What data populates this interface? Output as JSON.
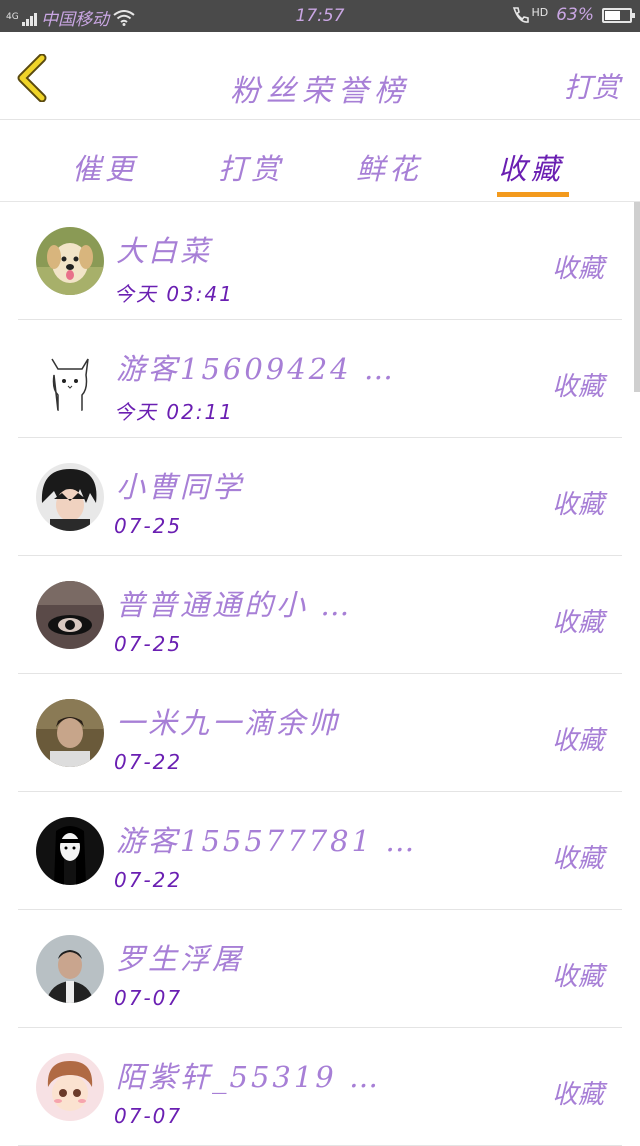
{
  "status_bar": {
    "network": "4G",
    "carrier": "中国移动",
    "time": "17:57",
    "hd": "HD",
    "battery_percent_label": "63%",
    "battery_level": 0.63,
    "signal_icon": "signal-bars-icon",
    "wifi_icon": "wifi-icon",
    "call_icon": "phone-hd-icon",
    "battery_icon": "battery-icon"
  },
  "header": {
    "back_icon": "chevron-left-icon",
    "title": "粉丝荣誉榜",
    "reward_label": "打赏"
  },
  "tabs": [
    {
      "label": "催更",
      "active": false
    },
    {
      "label": "打赏",
      "active": false
    },
    {
      "label": "鲜花",
      "active": false
    },
    {
      "label": "收藏",
      "active": true
    }
  ],
  "colors": {
    "accent_purple": "#a77fd6",
    "dark_purple": "#6a1fb2",
    "indicator_orange": "#f39a1d",
    "back_icon_yellow": "#f0d428"
  },
  "fans": [
    {
      "name": "大白菜",
      "time": "今天 03:41",
      "action": "收藏",
      "avatar": "puppy-avatar"
    },
    {
      "name": "游客15609424 …",
      "time": "今天 02:11",
      "action": "收藏",
      "avatar": "cat-sketch-avatar"
    },
    {
      "name": "小曹同学",
      "time": "07-25",
      "action": "收藏",
      "avatar": "anime-boy-avatar"
    },
    {
      "name": "普普通通的小 …",
      "time": "07-25",
      "action": "收藏",
      "avatar": "dark-eye-avatar"
    },
    {
      "name": "一米九一滴余帅",
      "time": "07-22",
      "action": "收藏",
      "avatar": "photo-boy-avatar"
    },
    {
      "name": "游客155577781 …",
      "time": "07-22",
      "action": "收藏",
      "avatar": "anime-girl-avatar"
    },
    {
      "name": "罗生浮屠",
      "time": "07-07",
      "action": "收藏",
      "avatar": "photo-man-avatar"
    },
    {
      "name": "陌紫轩_55319 …",
      "time": "07-07",
      "action": "收藏",
      "avatar": "cartoon-kid-avatar"
    }
  ]
}
